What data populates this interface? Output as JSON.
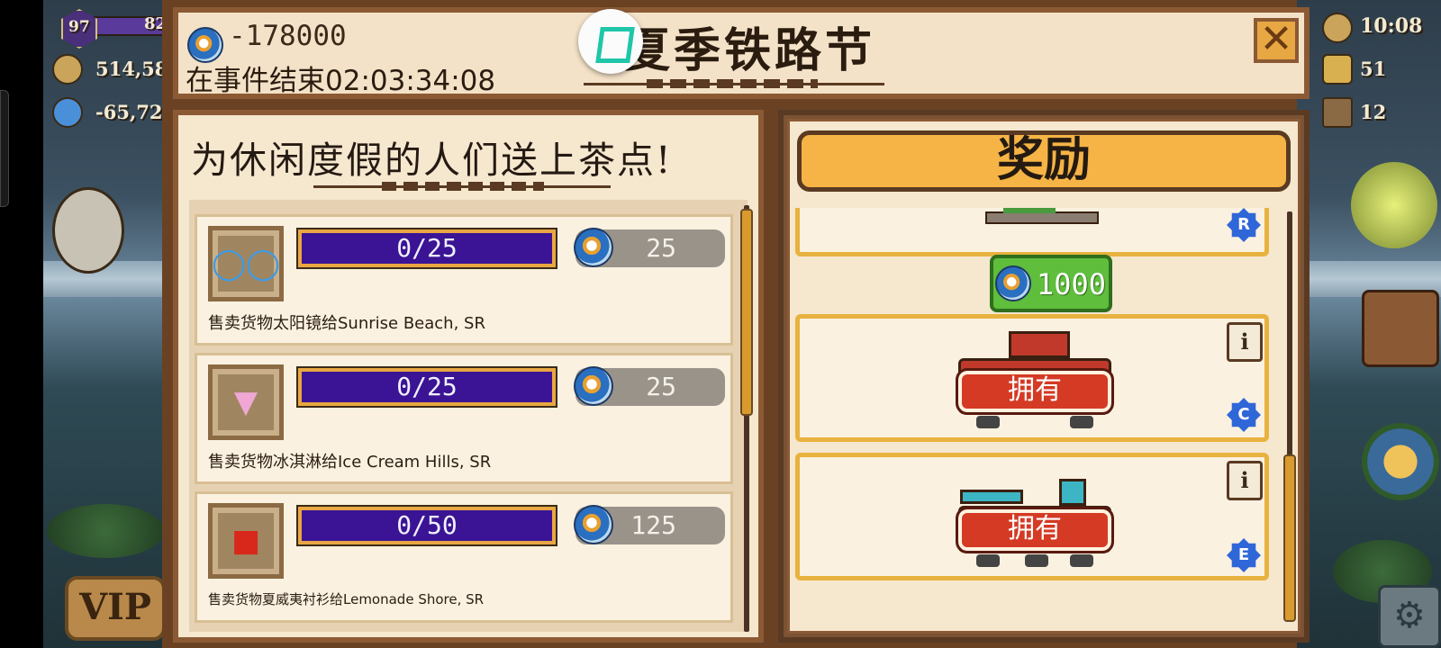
{
  "hud": {
    "level": "97",
    "level_progress": "82",
    "gold": "514,58",
    "gems": "-65,72",
    "time": "10:08",
    "workers": "51",
    "trains": "12",
    "vip": "VIP"
  },
  "header": {
    "event_coins": "-178000",
    "timer_label": "在事件结束02:03:34:08",
    "title": "夏季铁路节",
    "close_icon": "close-icon"
  },
  "quests": {
    "title": "为休闲度假的人们送上茶点!",
    "tasks": [
      {
        "item_icon": "sunglasses-icon",
        "progress": "0/25",
        "reward": "25",
        "description": "售卖货物太阳镜给Sunrise Beach, SR"
      },
      {
        "item_icon": "ice-cream-icon",
        "progress": "0/25",
        "reward": "25",
        "description": "售卖货物冰淇淋给Ice Cream Hills, SR"
      },
      {
        "item_icon": "hawaiian-shirt-icon",
        "progress": "0/50",
        "reward": "125",
        "description": "售卖货物夏威夷衬衫给Lemonade Shore, SR"
      }
    ]
  },
  "rewards": {
    "title": "奖励",
    "cards": [
      {
        "tier": "R",
        "cost": "1000"
      },
      {
        "tier": "C",
        "status": "拥有"
      },
      {
        "tier": "E",
        "status": "拥有"
      }
    ]
  },
  "colors": {
    "panel_bg": "#f6e7cf",
    "border_brown": "#8b5a34",
    "progress_purple": "#3a1494",
    "progress_border": "#e8a742",
    "owned_red": "#d43a24",
    "reward_header_orange": "#f5b445",
    "green_reward": "#5fbe3c",
    "tier_blue": "#2f67d8"
  }
}
